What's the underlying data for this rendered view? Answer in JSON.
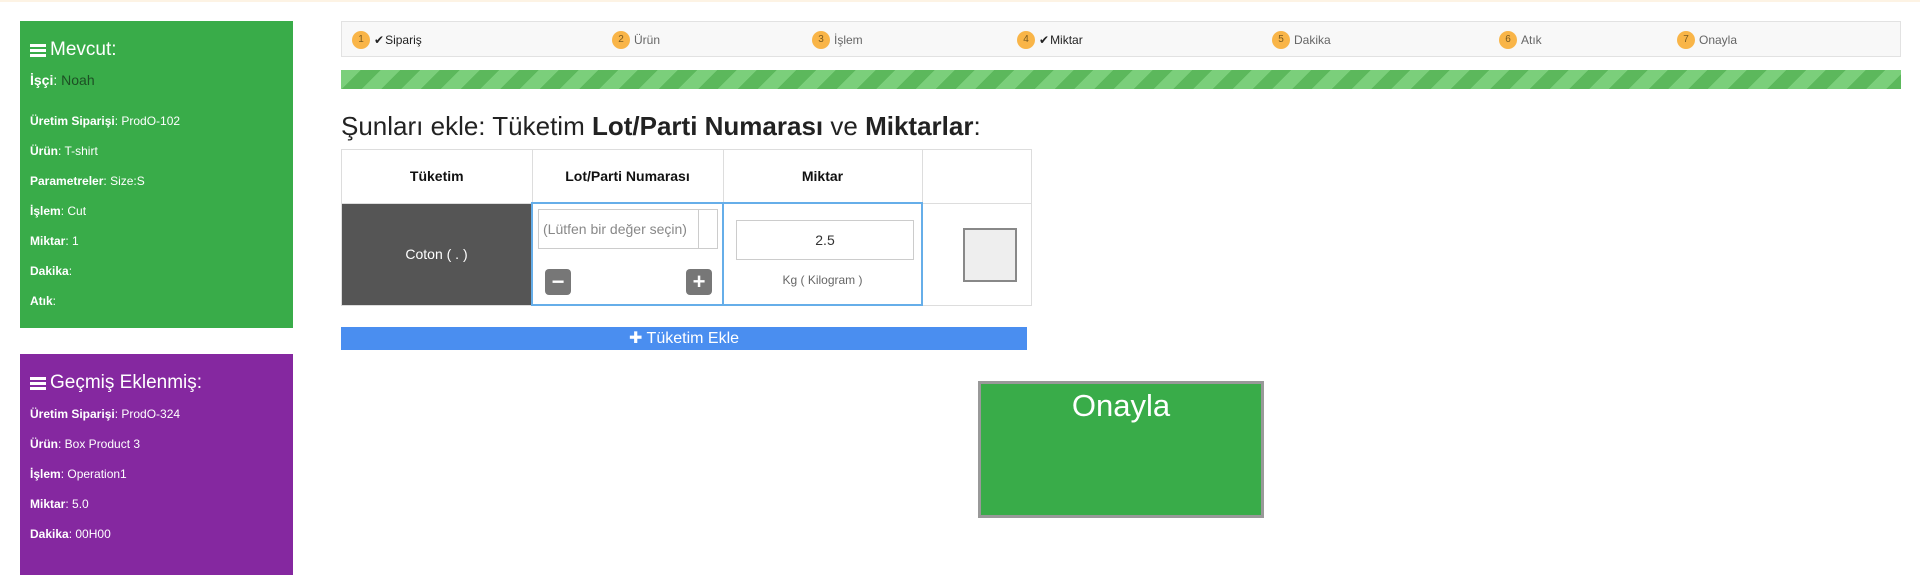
{
  "current_panel": {
    "title": "Mevcut:",
    "worker_label": "İşçi",
    "worker_value": "Noah",
    "rows": [
      {
        "label": "Üretim Siparişi",
        "value": "ProdO-102"
      },
      {
        "label": "Ürün",
        "value": "T-shirt"
      },
      {
        "label": "Parametreler",
        "value": "Size:S"
      },
      {
        "label": "İşlem",
        "value": "Cut"
      },
      {
        "label": "Miktar",
        "value": "1"
      },
      {
        "label": "Dakika",
        "value": ""
      },
      {
        "label": "Atık",
        "value": ""
      }
    ]
  },
  "history_panel": {
    "title": "Geçmiş Eklenmiş:",
    "rows": [
      {
        "label": "Üretim Siparişi",
        "value": "ProdO-324"
      },
      {
        "label": "Ürün",
        "value": "Box Product 3"
      },
      {
        "label": "İşlem",
        "value": "Operation1"
      },
      {
        "label": "Miktar",
        "value": "5.0"
      },
      {
        "label": "Dakika",
        "value": "00H00"
      }
    ]
  },
  "steps": [
    {
      "num": "1",
      "label": "Sipariş",
      "done": true
    },
    {
      "num": "2",
      "label": "Ürün",
      "done": false
    },
    {
      "num": "3",
      "label": "İşlem",
      "done": false
    },
    {
      "num": "4",
      "label": "Miktar",
      "done": true
    },
    {
      "num": "5",
      "label": "Dakika",
      "done": false
    },
    {
      "num": "6",
      "label": "Atık",
      "done": false
    },
    {
      "num": "7",
      "label": "Onayla",
      "done": false
    }
  ],
  "progress_percent": 100,
  "heading": {
    "part1": "Şunları ekle: Tüketim ",
    "bold1": "Lot/Parti Numarası",
    "part2": " ve ",
    "bold2": "Miktarlar",
    "part3": ":"
  },
  "table": {
    "headers": [
      "Tüketim",
      "Lot/Parti Numarası",
      "Miktar",
      ""
    ],
    "row": {
      "consumption": "Coton ( . )",
      "lot_placeholder": "(Lütfen bir değer seçin)",
      "quantity": "2.5",
      "unit": "Kg ( Kilogram )"
    }
  },
  "add_button": "Tüketim Ekle",
  "confirm_button": "Onayla",
  "colors": {
    "current_panel": "#39ac49",
    "history_panel": "#8528a0",
    "step_badge": "#f9b548",
    "add_button": "#4a8ef0",
    "confirm_button": "#39ac49"
  }
}
